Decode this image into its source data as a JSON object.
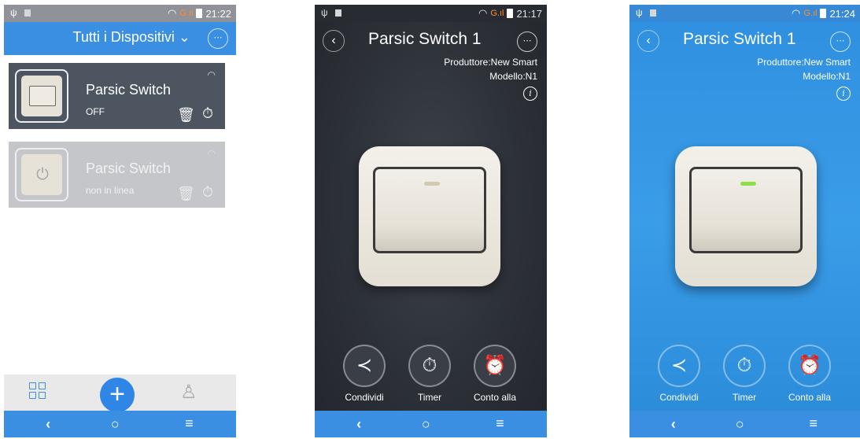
{
  "status": {
    "phone1_time": "21:22",
    "phone2_time": "21:17",
    "phone3_time": "21:24"
  },
  "list_screen": {
    "title": "Tutti i Dispositivi",
    "devices": [
      {
        "name": "Parsic Switch",
        "state": "OFF"
      },
      {
        "name": "Parsic Switch",
        "state": "non in linea"
      }
    ]
  },
  "detail_screens": [
    {
      "title": "Parsic Switch 1",
      "manufacturer": "Produttore:New Smart",
      "model": "Modello:N1",
      "actions": [
        "Condividi",
        "Timer",
        "Conto alla"
      ]
    },
    {
      "title": "Parsic Switch 1",
      "manufacturer": "Produttore:New Smart",
      "model": "Modello:N1",
      "actions": [
        "Condividi",
        "Timer",
        "Conto alla"
      ]
    }
  ],
  "icons": {
    "more": "⋯",
    "back": "‹",
    "nav_back": "‹",
    "nav_home": "○",
    "nav_menu": "≡",
    "plus": "+",
    "trash": "🗑",
    "timer": "⏱",
    "share": "≺",
    "alarm": "⏰",
    "power": "⏻",
    "user": "♙",
    "wifi": "◠",
    "info": "i",
    "usb": "ψ"
  },
  "colors": {
    "brand_blue": "#3b8fe3",
    "dark_bg": "#2c3037",
    "led_on": "#8ee04a"
  }
}
